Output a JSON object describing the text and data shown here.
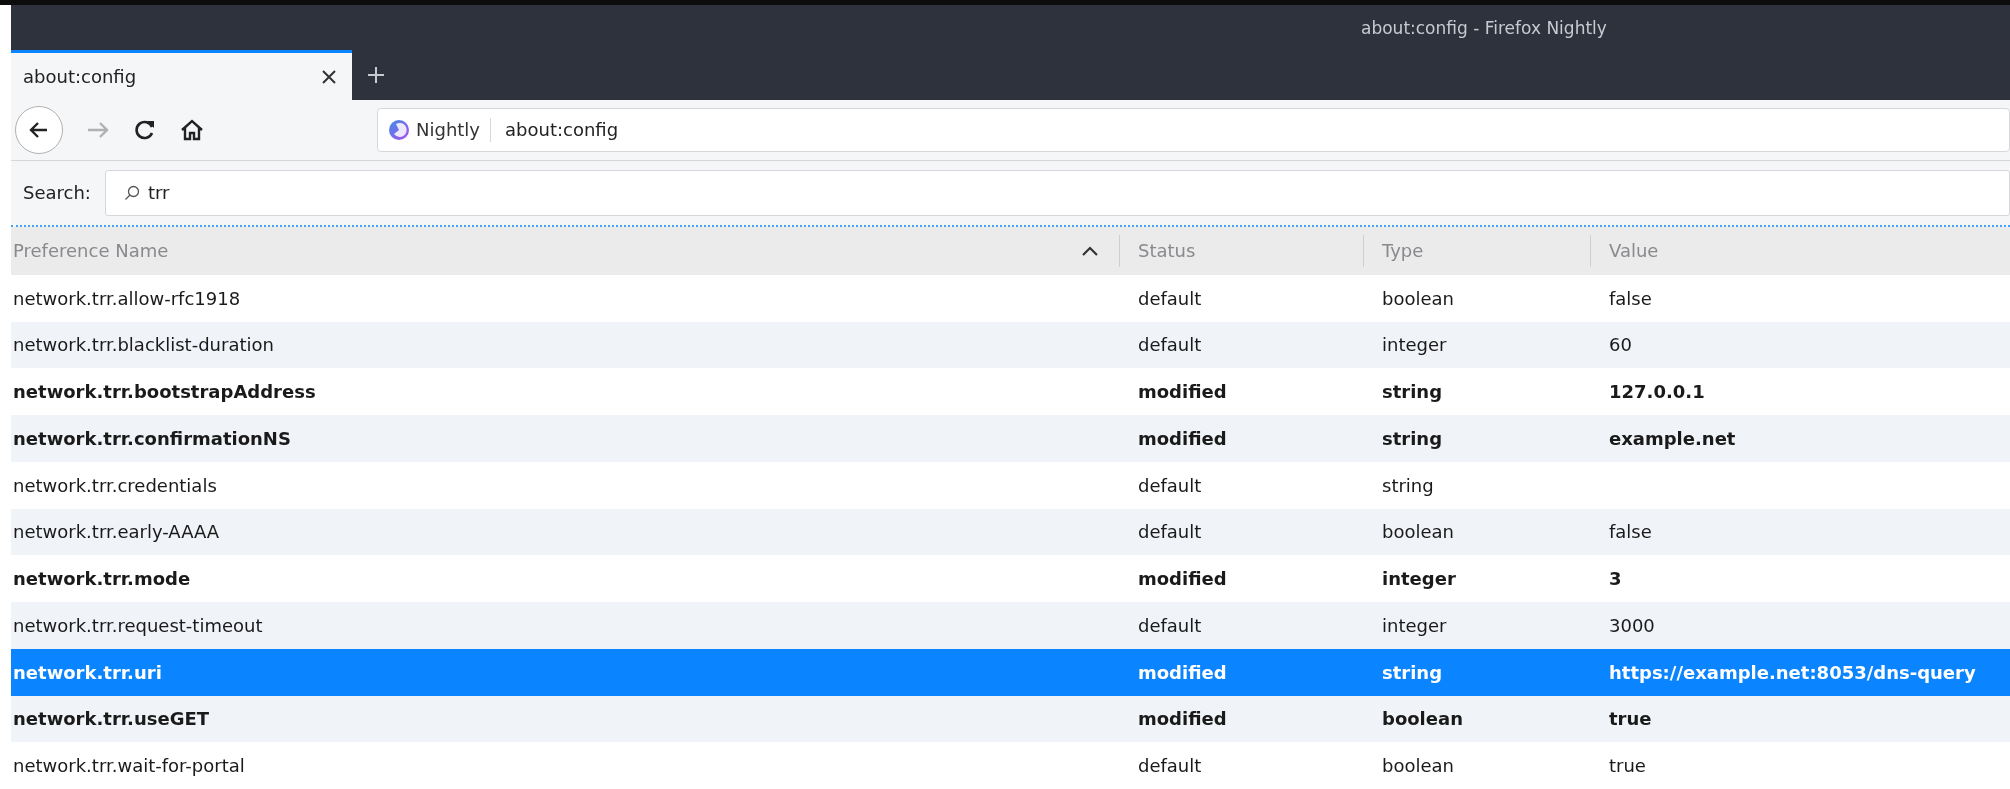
{
  "window": {
    "title": "about:config - Firefox Nightly"
  },
  "tabs": [
    {
      "label": "about:config",
      "selected": true
    }
  ],
  "toolbar": {
    "identity": "Nightly",
    "url": "about:config"
  },
  "search": {
    "label": "Search:",
    "value": "trr"
  },
  "table": {
    "columns": [
      {
        "label": "Preference Name",
        "sorted": true
      },
      {
        "label": "Status",
        "sorted": false
      },
      {
        "label": "Type",
        "sorted": false
      },
      {
        "label": "Value",
        "sorted": false
      }
    ],
    "rows": [
      {
        "name": "network.trr.allow-rfc1918",
        "status": "default",
        "type": "boolean",
        "value": "false",
        "modified": false,
        "selected": false
      },
      {
        "name": "network.trr.blacklist-duration",
        "status": "default",
        "type": "integer",
        "value": "60",
        "modified": false,
        "selected": false
      },
      {
        "name": "network.trr.bootstrapAddress",
        "status": "modified",
        "type": "string",
        "value": "127.0.0.1",
        "modified": true,
        "selected": false
      },
      {
        "name": "network.trr.confirmationNS",
        "status": "modified",
        "type": "string",
        "value": "example.net",
        "modified": true,
        "selected": false
      },
      {
        "name": "network.trr.credentials",
        "status": "default",
        "type": "string",
        "modified": false,
        "selected": false
      },
      {
        "name": "network.trr.early-AAAA",
        "status": "default",
        "type": "boolean",
        "value": "false",
        "modified": false,
        "selected": false
      },
      {
        "name": "network.trr.mode",
        "status": "modified",
        "type": "integer",
        "value": "3",
        "modified": true,
        "selected": false
      },
      {
        "name": "network.trr.request-timeout",
        "status": "default",
        "type": "integer",
        "value": "3000",
        "modified": false,
        "selected": false
      },
      {
        "name": "network.trr.uri",
        "status": "modified",
        "type": "string",
        "value": "https://example.net:8053/dns-query",
        "modified": true,
        "selected": true
      },
      {
        "name": "network.trr.useGET",
        "status": "modified",
        "type": "boolean",
        "value": "true",
        "modified": true,
        "selected": false
      },
      {
        "name": "network.trr.wait-for-portal",
        "status": "default",
        "type": "boolean",
        "value": "true",
        "modified": false,
        "selected": false
      }
    ]
  }
}
